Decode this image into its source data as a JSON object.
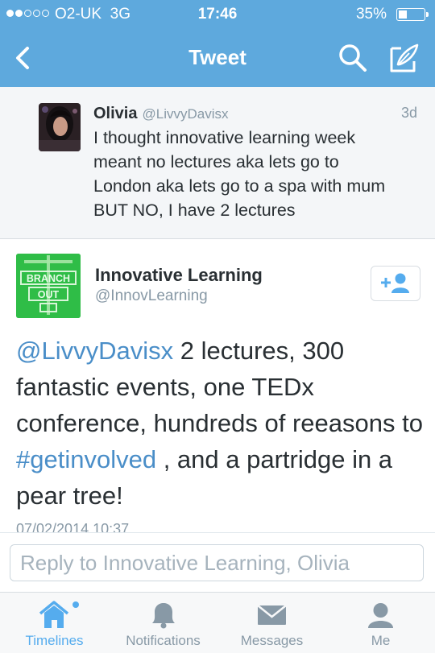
{
  "status_bar": {
    "carrier": "O2-UK",
    "network": "3G",
    "time": "17:46",
    "battery": "35%",
    "battery_level": 0.35
  },
  "nav": {
    "title": "Tweet"
  },
  "parent_tweet": {
    "name": "Olivia",
    "handle": "@LivvyDavisx",
    "age": "3d",
    "text": "I thought innovative learning week meant no lectures aka lets go to London aka lets go to a spa with mum BUT NO, I have 2 lectures"
  },
  "focused_tweet": {
    "name": "Innovative Learning",
    "handle": "@InnovLearning",
    "mention": "@LivvyDavisx",
    "text_part1": " 2 lectures, 300 fantastic events, one TEDx conference, hundreds of reeasons to ",
    "hashtag": "#getinvolved",
    "text_part2": " , and a partridge in a pear tree!",
    "timestamp": "07/02/2014 10:37",
    "avatar_logo_text": [
      "BRANCH",
      "OUT"
    ]
  },
  "reply": {
    "placeholder": "Reply to Innovative Learning, Olivia"
  },
  "tabs": [
    {
      "label": "Timelines",
      "icon": "home-icon",
      "active": true
    },
    {
      "label": "Notifications",
      "icon": "bell-icon",
      "active": false
    },
    {
      "label": "Messages",
      "icon": "envelope-icon",
      "active": false
    },
    {
      "label": "Me",
      "icon": "person-icon",
      "active": false
    }
  ],
  "colors": {
    "brand_blue": "#5ea9dd",
    "link_blue": "#4a8ec8",
    "active_tab": "#55acee",
    "inactive": "#8899a6",
    "logo_green": "#2fbd47"
  }
}
